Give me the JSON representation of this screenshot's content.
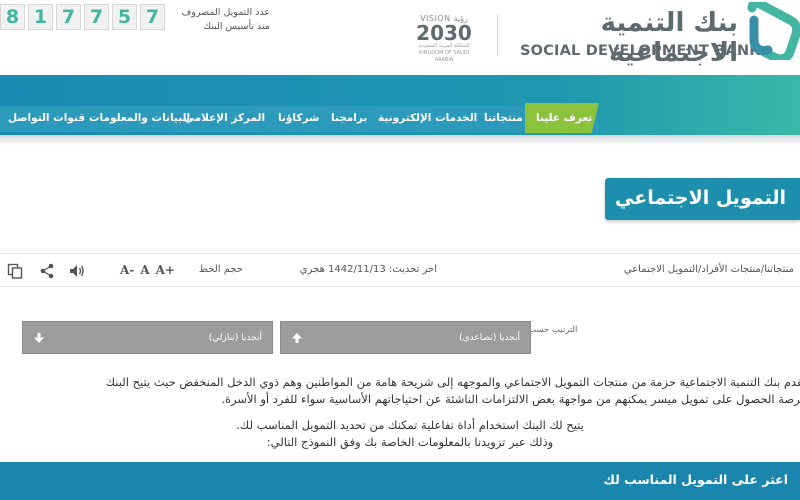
{
  "header": {
    "counter_digits": [
      "8",
      "1",
      "7",
      "7",
      "5",
      "7"
    ],
    "counter_label_line1": "عدد التمويل المصروف",
    "counter_label_line2": "منذ تأسيس البنك",
    "vision_label": "VISION رؤية",
    "vision_year": "2030",
    "vision_sub1": "المملكة العربية السعودية",
    "vision_sub2": "KINGDOM OF SAUDI ARABIA",
    "bank_name_ar": "بنك التنمية الاجتماعية",
    "bank_name_en": "SOCIAL DEVELOPMENT BANK",
    "colors": {
      "accent": "#43b6a2",
      "text": "#5e6a6e"
    }
  },
  "nav": {
    "active_color": "#8bc33d",
    "items": [
      {
        "label": "تعرف علينا"
      },
      {
        "label": "منتجاتنا"
      },
      {
        "label": "الخدمات الإلكترونية"
      },
      {
        "label": "برامجنا"
      },
      {
        "label": "شركاؤنا"
      },
      {
        "label": "المركز الإعلامي"
      },
      {
        "label": "البيانات والمعلومات"
      },
      {
        "label": "قنوات التواصل"
      }
    ]
  },
  "page": {
    "title": "التمويل الاجتماعي",
    "breadcrumb": "منتجاتنا/منتجات الأفراد/التمويل الاجتماعي",
    "last_update": "اخر تحديث: 1442/11/13 هجري",
    "font_size_label": "حجم الخط",
    "font_sizes": {
      "increase": "A+",
      "normal": "A",
      "decrease": "A-"
    },
    "tool_icons": [
      "sound-icon",
      "share-icon",
      "copy-icon"
    ]
  },
  "sort": {
    "label": "الترتيب حسب",
    "asc_label": "أبجديا (تصاعدي)",
    "desc_label": "أبجديا (تنازلي)"
  },
  "content": {
    "para1_line1": "يقدم بنك التنمية الاجتماعية حزمة من منتجات التمويل الاجتماعي والموجهه إلى شريحة هامة من المواطنين وهم ذوي الدخل المنخفض حيث يتيح البنك",
    "para1_line2": "فرصة الحصول على تمويل ميسر يمكنهم من مواجهة بعض الالتزامات الناشئة عن احتياجاتهم الأساسية سواء للفرد أو الأسرة.",
    "para2_line1": "يتيح لك البنك استخدام أداة تفاعلية تمكنك من تحديد التمويل المناسب لك.",
    "para2_line2": "وذلك عبر تزويدنا بالمعلومات الخاصة بك وفق النموذج التالي:"
  },
  "footer_bar": {
    "title": "اعثر على التمويل المناسب لك"
  }
}
